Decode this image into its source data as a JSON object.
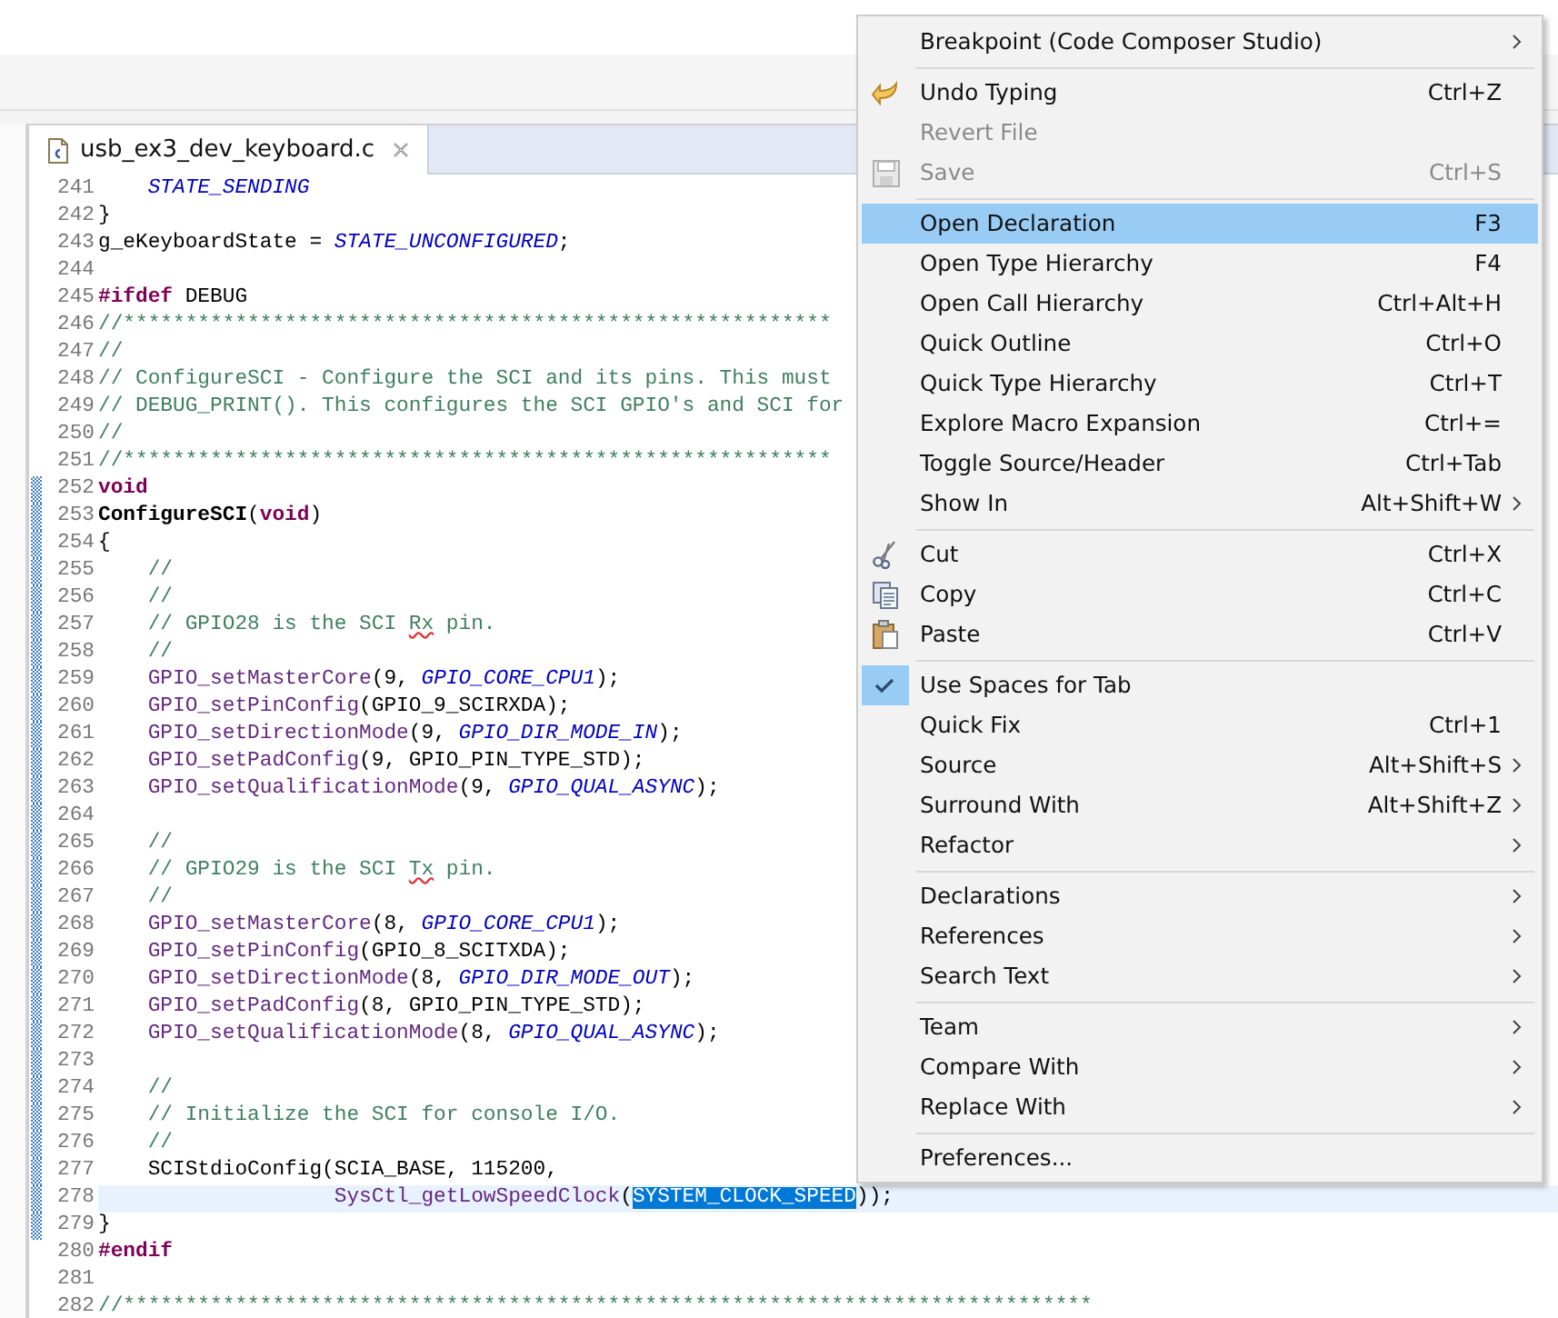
{
  "editor": {
    "tab": {
      "title": "usb_ex3_dev_keyboard.c",
      "selected": true
    },
    "lines": [
      {
        "number": "241",
        "changed": false,
        "current": false,
        "tokens": [
          {
            "kind": "enum",
            "text": "    STATE_SENDING"
          }
        ]
      },
      {
        "number": "242",
        "changed": false,
        "current": false,
        "tokens": [
          {
            "kind": "plain",
            "text": "}"
          }
        ]
      },
      {
        "number": "243",
        "changed": false,
        "current": false,
        "tokens": [
          {
            "kind": "plain",
            "text": "g_eKeyboardState = "
          },
          {
            "kind": "enum",
            "text": "STATE_UNCONFIGURED"
          },
          {
            "kind": "plain",
            "text": ";"
          }
        ]
      },
      {
        "number": "244",
        "changed": false,
        "current": false
      },
      {
        "number": "245",
        "changed": false,
        "current": false,
        "tokens": [
          {
            "kind": "keyword",
            "text": "#ifdef"
          },
          {
            "kind": "plain",
            "text": " DEBUG"
          }
        ]
      },
      {
        "number": "246",
        "changed": false,
        "current": false,
        "tokens": [
          {
            "kind": "comment",
            "text": "//*********************************************************"
          }
        ]
      },
      {
        "number": "247",
        "changed": false,
        "current": false,
        "tokens": [
          {
            "kind": "comment",
            "text": "//"
          }
        ]
      },
      {
        "number": "248",
        "changed": false,
        "current": false,
        "tokens": [
          {
            "kind": "comment",
            "text": "// ConfigureSCI - Configure the SCI and its pins. This must"
          }
        ]
      },
      {
        "number": "249",
        "changed": false,
        "current": false,
        "tokens": [
          {
            "kind": "comment",
            "text": "// DEBUG_PRINT(). This configures the SCI GPIO's and SCI for"
          }
        ]
      },
      {
        "number": "250",
        "changed": false,
        "current": false,
        "tokens": [
          {
            "kind": "comment",
            "text": "//"
          }
        ]
      },
      {
        "number": "251",
        "changed": false,
        "current": false,
        "tokens": [
          {
            "kind": "comment",
            "text": "//*********************************************************"
          }
        ]
      },
      {
        "number": "252",
        "changed": true,
        "current": false,
        "tokens": [
          {
            "kind": "keyword",
            "text": "void"
          }
        ]
      },
      {
        "number": "253",
        "changed": true,
        "current": false,
        "tokens": [
          {
            "kind": "definition",
            "text": "ConfigureSCI"
          },
          {
            "kind": "plain",
            "text": "("
          },
          {
            "kind": "keyword",
            "text": "void"
          },
          {
            "kind": "plain",
            "text": ")"
          }
        ]
      },
      {
        "number": "254",
        "changed": true,
        "current": false,
        "tokens": [
          {
            "kind": "plain",
            "text": "{"
          }
        ]
      },
      {
        "number": "255",
        "changed": true,
        "current": false,
        "tokens": [
          {
            "kind": "comment",
            "text": "    //"
          }
        ]
      },
      {
        "number": "256",
        "changed": true,
        "current": false,
        "tokens": [
          {
            "kind": "comment",
            "text": "    //"
          }
        ]
      },
      {
        "number": "257",
        "changed": true,
        "current": false,
        "tokens": [
          {
            "kind": "comment",
            "text": "    // GPIO28 is the SCI "
          },
          {
            "kind": "misspelled",
            "text": "Rx"
          },
          {
            "kind": "comment",
            "text": " pin."
          }
        ]
      },
      {
        "number": "258",
        "changed": true,
        "current": false,
        "tokens": [
          {
            "kind": "comment",
            "text": "    //"
          }
        ]
      },
      {
        "number": "259",
        "changed": true,
        "current": false,
        "tokens": [
          {
            "kind": "function",
            "text": "    GPIO_setMasterCore"
          },
          {
            "kind": "plain",
            "text": "(9, "
          },
          {
            "kind": "enum",
            "text": "GPIO_CORE_CPU1"
          },
          {
            "kind": "plain",
            "text": ");"
          }
        ]
      },
      {
        "number": "260",
        "changed": true,
        "current": false,
        "tokens": [
          {
            "kind": "function",
            "text": "    GPIO_setPinConfig"
          },
          {
            "kind": "plain",
            "text": "(GPIO_9_SCIRXDA);"
          }
        ]
      },
      {
        "number": "261",
        "changed": true,
        "current": false,
        "tokens": [
          {
            "kind": "function",
            "text": "    GPIO_setDirectionMode"
          },
          {
            "kind": "plain",
            "text": "(9, "
          },
          {
            "kind": "enum",
            "text": "GPIO_DIR_MODE_IN"
          },
          {
            "kind": "plain",
            "text": ");"
          }
        ]
      },
      {
        "number": "262",
        "changed": true,
        "current": false,
        "tokens": [
          {
            "kind": "function",
            "text": "    GPIO_setPadConfig"
          },
          {
            "kind": "plain",
            "text": "(9, GPIO_PIN_TYPE_STD);"
          }
        ]
      },
      {
        "number": "263",
        "changed": true,
        "current": false,
        "tokens": [
          {
            "kind": "function",
            "text": "    GPIO_setQualificationMode"
          },
          {
            "kind": "plain",
            "text": "(9, "
          },
          {
            "kind": "enum",
            "text": "GPIO_QUAL_ASYNC"
          },
          {
            "kind": "plain",
            "text": ");"
          }
        ]
      },
      {
        "number": "264",
        "changed": true,
        "current": false
      },
      {
        "number": "265",
        "changed": true,
        "current": false,
        "tokens": [
          {
            "kind": "comment",
            "text": "    //"
          }
        ]
      },
      {
        "number": "266",
        "changed": true,
        "current": false,
        "tokens": [
          {
            "kind": "comment",
            "text": "    // GPIO29 is the SCI "
          },
          {
            "kind": "misspelled",
            "text": "Tx"
          },
          {
            "kind": "comment",
            "text": " pin."
          }
        ]
      },
      {
        "number": "267",
        "changed": true,
        "current": false,
        "tokens": [
          {
            "kind": "comment",
            "text": "    //"
          }
        ]
      },
      {
        "number": "268",
        "changed": true,
        "current": false,
        "tokens": [
          {
            "kind": "function",
            "text": "    GPIO_setMasterCore"
          },
          {
            "kind": "plain",
            "text": "(8, "
          },
          {
            "kind": "enum",
            "text": "GPIO_CORE_CPU1"
          },
          {
            "kind": "plain",
            "text": ");"
          }
        ]
      },
      {
        "number": "269",
        "changed": true,
        "current": false,
        "tokens": [
          {
            "kind": "function",
            "text": "    GPIO_setPinConfig"
          },
          {
            "kind": "plain",
            "text": "(GPIO_8_SCITXDA);"
          }
        ]
      },
      {
        "number": "270",
        "changed": true,
        "current": false,
        "tokens": [
          {
            "kind": "function",
            "text": "    GPIO_setDirectionMode"
          },
          {
            "kind": "plain",
            "text": "(8, "
          },
          {
            "kind": "enum",
            "text": "GPIO_DIR_MODE_OUT"
          },
          {
            "kind": "plain",
            "text": ");"
          }
        ]
      },
      {
        "number": "271",
        "changed": true,
        "current": false,
        "tokens": [
          {
            "kind": "function",
            "text": "    GPIO_setPadConfig"
          },
          {
            "kind": "plain",
            "text": "(8, GPIO_PIN_TYPE_STD);"
          }
        ]
      },
      {
        "number": "272",
        "changed": true,
        "current": false,
        "tokens": [
          {
            "kind": "function",
            "text": "    GPIO_setQualificationMode"
          },
          {
            "kind": "plain",
            "text": "(8, "
          },
          {
            "kind": "enum",
            "text": "GPIO_QUAL_ASYNC"
          },
          {
            "kind": "plain",
            "text": ");"
          }
        ]
      },
      {
        "number": "273",
        "changed": true,
        "current": false
      },
      {
        "number": "274",
        "changed": true,
        "current": false,
        "tokens": [
          {
            "kind": "comment",
            "text": "    //"
          }
        ]
      },
      {
        "number": "275",
        "changed": true,
        "current": false,
        "tokens": [
          {
            "kind": "comment",
            "text": "    // Initialize the SCI for console I/O."
          }
        ]
      },
      {
        "number": "276",
        "changed": true,
        "current": false,
        "tokens": [
          {
            "kind": "comment",
            "text": "    //"
          }
        ]
      },
      {
        "number": "277",
        "changed": true,
        "current": false,
        "tokens": [
          {
            "kind": "plain",
            "text": "    SCIStdioConfig(SCIA_BASE, 115200,"
          }
        ]
      },
      {
        "number": "278",
        "changed": true,
        "current": true,
        "tokens": [
          {
            "kind": "function",
            "text": "                   SysCtl_getLowSpeedClock"
          },
          {
            "kind": "plain",
            "text": "("
          },
          {
            "kind": "selected",
            "text": "SYSTEM_CLOCK_SPEED"
          },
          {
            "kind": "plain",
            "text": "));"
          }
        ]
      },
      {
        "number": "279",
        "changed": true,
        "current": false,
        "tokens": [
          {
            "kind": "plain",
            "text": "}"
          }
        ]
      },
      {
        "number": "280",
        "changed": false,
        "current": false,
        "tokens": [
          {
            "kind": "keyword",
            "text": "#endif"
          }
        ]
      },
      {
        "number": "281",
        "changed": false,
        "current": false
      },
      {
        "number": "282",
        "changed": false,
        "current": false,
        "tokens": [
          {
            "kind": "comment",
            "text": "//******************************************************************************"
          }
        ]
      }
    ]
  },
  "context_menu": {
    "items": [
      {
        "kind": "item",
        "label": "Breakpoint (Code Composer Studio)",
        "submenu": true,
        "disabled": false,
        "selected": false,
        "checked": false
      },
      {
        "kind": "separator"
      },
      {
        "kind": "undo",
        "label": "Undo Typing",
        "shortcut": "Ctrl+Z",
        "submenu": false,
        "disabled": false,
        "selected": false,
        "checked": false
      },
      {
        "kind": "item",
        "label": "Revert File",
        "submenu": false,
        "disabled": true,
        "selected": false,
        "checked": false
      },
      {
        "kind": "save",
        "label": "Save",
        "shortcut": "Ctrl+S",
        "submenu": false,
        "disabled": true,
        "selected": false,
        "checked": false
      },
      {
        "kind": "separator"
      },
      {
        "kind": "item",
        "label": "Open Declaration",
        "shortcut": "F3",
        "submenu": false,
        "disabled": false,
        "selected": true,
        "checked": false
      },
      {
        "kind": "item",
        "label": "Open Type Hierarchy",
        "shortcut": "F4",
        "submenu": false,
        "disabled": false,
        "selected": false,
        "checked": false
      },
      {
        "kind": "item",
        "label": "Open Call Hierarchy",
        "shortcut": "Ctrl+Alt+H",
        "submenu": false,
        "disabled": false,
        "selected": false,
        "checked": false
      },
      {
        "kind": "item",
        "label": "Quick Outline",
        "shortcut": "Ctrl+O",
        "submenu": false,
        "disabled": false,
        "selected": false,
        "checked": false
      },
      {
        "kind": "item",
        "label": "Quick Type Hierarchy",
        "shortcut": "Ctrl+T",
        "submenu": false,
        "disabled": false,
        "selected": false,
        "checked": false
      },
      {
        "kind": "item",
        "label": "Explore Macro Expansion",
        "shortcut": "Ctrl+=",
        "submenu": false,
        "disabled": false,
        "selected": false,
        "checked": false
      },
      {
        "kind": "item",
        "label": "Toggle Source/Header",
        "shortcut": "Ctrl+Tab",
        "submenu": false,
        "disabled": false,
        "selected": false,
        "checked": false
      },
      {
        "kind": "item",
        "label": "Show In",
        "shortcut": "Alt+Shift+W",
        "submenu": true,
        "disabled": false,
        "selected": false,
        "checked": false
      },
      {
        "kind": "separator"
      },
      {
        "kind": "cut",
        "label": "Cut",
        "shortcut": "Ctrl+X",
        "submenu": false,
        "disabled": false,
        "selected": false,
        "checked": false
      },
      {
        "kind": "copy",
        "label": "Copy",
        "shortcut": "Ctrl+C",
        "submenu": false,
        "disabled": false,
        "selected": false,
        "checked": false
      },
      {
        "kind": "paste",
        "label": "Paste",
        "shortcut": "Ctrl+V",
        "submenu": false,
        "disabled": false,
        "selected": false,
        "checked": false
      },
      {
        "kind": "separator"
      },
      {
        "kind": "item",
        "label": "Use Spaces for Tab",
        "submenu": false,
        "disabled": false,
        "selected": false,
        "checked": true
      },
      {
        "kind": "item",
        "label": "Quick Fix",
        "shortcut": "Ctrl+1",
        "submenu": false,
        "disabled": false,
        "selected": false,
        "checked": false
      },
      {
        "kind": "item",
        "label": "Source",
        "shortcut": "Alt+Shift+S",
        "submenu": true,
        "disabled": false,
        "selected": false,
        "checked": false
      },
      {
        "kind": "item",
        "label": "Surround With",
        "shortcut": "Alt+Shift+Z",
        "submenu": true,
        "disabled": false,
        "selected": false,
        "checked": false
      },
      {
        "kind": "item",
        "label": "Refactor",
        "submenu": true,
        "disabled": false,
        "selected": false,
        "checked": false
      },
      {
        "kind": "separator"
      },
      {
        "kind": "item",
        "label": "Declarations",
        "submenu": true,
        "disabled": false,
        "selected": false,
        "checked": false
      },
      {
        "kind": "item",
        "label": "References",
        "submenu": true,
        "disabled": false,
        "selected": false,
        "checked": false
      },
      {
        "kind": "item",
        "label": "Search Text",
        "submenu": true,
        "disabled": false,
        "selected": false,
        "checked": false
      },
      {
        "kind": "separator"
      },
      {
        "kind": "item",
        "label": "Team",
        "submenu": true,
        "disabled": false,
        "selected": false,
        "checked": false
      },
      {
        "kind": "item",
        "label": "Compare With",
        "submenu": true,
        "disabled": false,
        "selected": false,
        "checked": false
      },
      {
        "kind": "item",
        "label": "Replace With",
        "submenu": true,
        "disabled": false,
        "selected": false,
        "checked": false
      },
      {
        "kind": "separator"
      },
      {
        "kind": "item",
        "label": "Preferences...",
        "submenu": false,
        "disabled": false,
        "selected": false,
        "checked": false
      }
    ]
  }
}
